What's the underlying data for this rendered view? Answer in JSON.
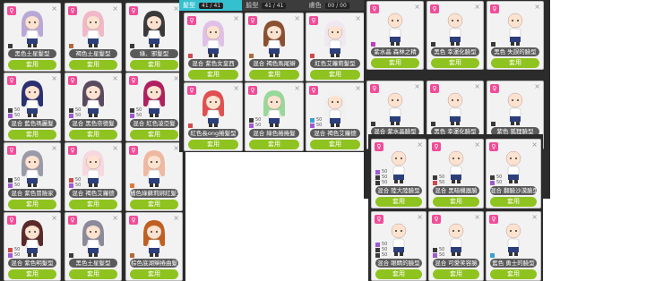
{
  "tabs": [
    {
      "label": "髮型",
      "count": "41 / 41",
      "active": true
    },
    {
      "label": "臉型",
      "count": "41 / 41",
      "active": false
    },
    {
      "label": "膚色",
      "count": "00 / 00",
      "active": false
    }
  ],
  "button_label": "套用",
  "badge_glyph": "♀",
  "swatch_value": "50",
  "panelA_cards": [
    {
      "name": "黑色土星髮型",
      "swatches": [
        {
          "color": "#3a3a3a"
        }
      ]
    },
    {
      "name": "褐色土星髮型",
      "swatches": [
        {
          "color": "#b06a3b"
        }
      ]
    },
    {
      "name": "綠、邪髮型",
      "swatches": [
        {
          "color": "#3a3a3a"
        }
      ]
    },
    {
      "name": "混合 藍色瑪麗髮",
      "swatches": [
        {
          "color": "#3a3a3a",
          "v": "50"
        },
        {
          "color": "#a05ad0",
          "v": "50"
        }
      ]
    },
    {
      "name": "混合 黑色奈德髮",
      "swatches": [
        {
          "color": "#3a3a3a",
          "v": "50"
        },
        {
          "color": "#a05ad0",
          "v": "50"
        }
      ]
    },
    {
      "name": "混合 紅色凌亞髮",
      "swatches": [
        {
          "color": "#3a3a3a",
          "v": "50"
        },
        {
          "color": "#a05ad0",
          "v": "50"
        }
      ]
    },
    {
      "name": "混合 紫色冒險家",
      "swatches": [
        {
          "color": "#3a3a3a",
          "v": "50"
        },
        {
          "color": "#a05ad0",
          "v": "50"
        }
      ]
    },
    {
      "name": "混合 褐色艾蘿德",
      "swatches": [
        {
          "color": "#d04a4a",
          "v": "50"
        },
        {
          "color": "#a05ad0",
          "v": "50"
        }
      ]
    },
    {
      "name": "橘色綠蘇莉綁紅髮型",
      "swatches": [
        {
          "color": "#e07a3a"
        }
      ]
    },
    {
      "name": "混合 紫色明髮型",
      "swatches": [
        {
          "color": "#d04a4a",
          "v": "50"
        },
        {
          "color": "#a05ad0",
          "v": "50"
        }
      ]
    },
    {
      "name": "黑色土星髮型",
      "swatches": [
        {
          "color": "#3a3a3a"
        }
      ]
    },
    {
      "name": "棕色底湖辮捲曲髮",
      "swatches": [
        {
          "color": "#b06a3b"
        }
      ]
    }
  ],
  "panelB_cards": [
    {
      "name": "混合 紫色女皇西",
      "swatches": [
        {
          "color": "#d04a4a"
        }
      ]
    },
    {
      "name": "混合 褐色馬尾辮",
      "swatches": [
        {
          "color": "#b06a3b"
        }
      ]
    },
    {
      "name": "紅色艾蘿莉髮型",
      "swatches": [
        {
          "color": "#d04a4a"
        }
      ]
    },
    {
      "name": "紅色長ong捲髮型",
      "swatches": [
        {
          "color": "#d04a4a"
        }
      ]
    },
    {
      "name": "混合 綠色捲捲髮",
      "swatches": [
        {
          "color": "#3a3a3a",
          "v": "50"
        },
        {
          "color": "#a05ad0",
          "v": "50"
        }
      ]
    },
    {
      "name": "混合 褐色艾蘿德",
      "swatches": [
        {
          "color": "#3aa0d0",
          "v": "50"
        },
        {
          "color": "#a05ad0",
          "v": "50"
        }
      ]
    }
  ],
  "panelC_cards": [
    {
      "name": "紫水晶 森林之精",
      "swatches": [
        {
          "color": "#c040c0"
        }
      ]
    },
    {
      "name": "黑色 幸運化臉型",
      "swatches": [
        {
          "color": "#3a3a3a"
        }
      ]
    },
    {
      "name": "黑色 失誤的臉型",
      "swatches": [
        {
          "color": "#3a3a3a"
        }
      ]
    },
    {
      "name": "混合 紫水晶臉型",
      "swatches": [
        {
          "color": "#3a3a3a"
        }
      ]
    },
    {
      "name": "黑色 幸運化臉型",
      "swatches": [
        {
          "color": "#3a3a3a"
        }
      ]
    },
    {
      "name": "紫色 狐狸臉型",
      "swatches": [
        {
          "color": "#3a3a3a"
        }
      ]
    }
  ],
  "panelD_cards": [
    {
      "name": "混合 陸大陸臉型",
      "swatches": [
        {
          "color": "#a05ad0",
          "v": "50"
        },
        {
          "color": "#3a3a3a",
          "v": "50"
        },
        {
          "color": "#3a3a3a",
          "v": "50"
        }
      ]
    },
    {
      "name": "混合 黑暗機器臉",
      "swatches": [
        {
          "color": "#3a3a3a",
          "v": "50"
        },
        {
          "color": "#d04a4a",
          "v": "50"
        }
      ]
    },
    {
      "name": "混合 翻臉沙漠臉型",
      "swatches": [
        {
          "color": "#3a3a3a",
          "v": "50"
        },
        {
          "color": "#a05ad0",
          "v": "50"
        }
      ]
    },
    {
      "name": "混合 眼睛的臉型",
      "swatches": [
        {
          "color": "#a05ad0",
          "v": "50"
        },
        {
          "color": "#3a3a3a",
          "v": "50"
        },
        {
          "color": "#3a3a3a",
          "v": "50"
        }
      ]
    },
    {
      "name": "混合 可愛笑容臉",
      "swatches": [
        {
          "color": "#3a3a3a",
          "v": "50"
        },
        {
          "color": "#a05ad0",
          "v": "50"
        }
      ]
    },
    {
      "name": "藍色 勇士的臉型",
      "swatches": [
        {
          "color": "#3aa0d0"
        }
      ]
    }
  ]
}
